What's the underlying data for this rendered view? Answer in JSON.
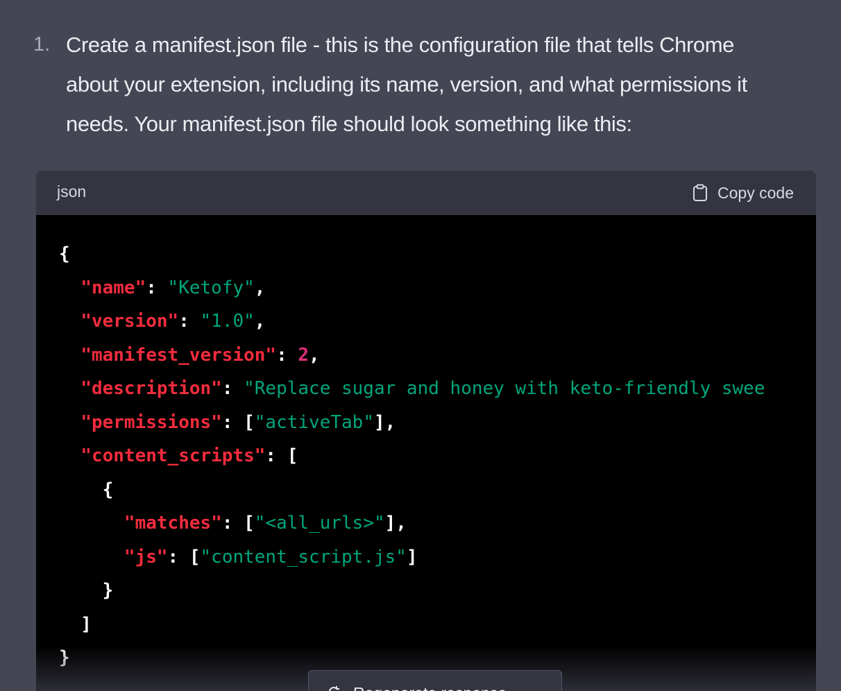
{
  "message": {
    "list_number": "1.",
    "paragraph_lines": [
      "Create a manifest.json file - this is the configuration file that tells Chrome",
      "about your extension, including its name, version, and what permissions it",
      "needs. Your manifest.json file should look something like this:"
    ]
  },
  "code_block": {
    "language": "json",
    "copy_label": "Copy code",
    "lines": [
      [
        {
          "t": "punc",
          "v": "{"
        }
      ],
      [
        {
          "t": "punc",
          "v": "  "
        },
        {
          "t": "key",
          "v": "\"name\""
        },
        {
          "t": "punc",
          "v": ": "
        },
        {
          "t": "str",
          "v": "\"Ketofy\""
        },
        {
          "t": "punc",
          "v": ","
        }
      ],
      [
        {
          "t": "punc",
          "v": "  "
        },
        {
          "t": "key",
          "v": "\"version\""
        },
        {
          "t": "punc",
          "v": ": "
        },
        {
          "t": "str",
          "v": "\"1.0\""
        },
        {
          "t": "punc",
          "v": ","
        }
      ],
      [
        {
          "t": "punc",
          "v": "  "
        },
        {
          "t": "key",
          "v": "\"manifest_version\""
        },
        {
          "t": "punc",
          "v": ": "
        },
        {
          "t": "num",
          "v": "2"
        },
        {
          "t": "punc",
          "v": ","
        }
      ],
      [
        {
          "t": "punc",
          "v": "  "
        },
        {
          "t": "key",
          "v": "\"description\""
        },
        {
          "t": "punc",
          "v": ": "
        },
        {
          "t": "str",
          "v": "\"Replace sugar and honey with keto-friendly swee"
        }
      ],
      [
        {
          "t": "punc",
          "v": "  "
        },
        {
          "t": "key",
          "v": "\"permissions\""
        },
        {
          "t": "punc",
          "v": ": ["
        },
        {
          "t": "str",
          "v": "\"activeTab\""
        },
        {
          "t": "punc",
          "v": "],"
        }
      ],
      [
        {
          "t": "punc",
          "v": "  "
        },
        {
          "t": "key",
          "v": "\"content_scripts\""
        },
        {
          "t": "punc",
          "v": ": ["
        }
      ],
      [
        {
          "t": "punc",
          "v": "    {"
        }
      ],
      [
        {
          "t": "punc",
          "v": "      "
        },
        {
          "t": "key",
          "v": "\"matches\""
        },
        {
          "t": "punc",
          "v": ": ["
        },
        {
          "t": "str",
          "v": "\"<all_urls>\""
        },
        {
          "t": "punc",
          "v": "],"
        }
      ],
      [
        {
          "t": "punc",
          "v": "      "
        },
        {
          "t": "key",
          "v": "\"js\""
        },
        {
          "t": "punc",
          "v": ": ["
        },
        {
          "t": "str",
          "v": "\"content_script.js\""
        },
        {
          "t": "punc",
          "v": "]"
        }
      ],
      [
        {
          "t": "punc",
          "v": "    }"
        }
      ],
      [
        {
          "t": "punc",
          "v": "  ]"
        }
      ],
      [
        {
          "t": "punc",
          "v": "}"
        }
      ]
    ]
  },
  "regenerate": {
    "icon": "refresh-icon",
    "label": "Regenerate response"
  },
  "colors": {
    "background": "#444654",
    "code_background": "#000000",
    "code_header": "#343541",
    "key": "#f22c3d",
    "string": "#00a67d",
    "number": "#df3079"
  }
}
